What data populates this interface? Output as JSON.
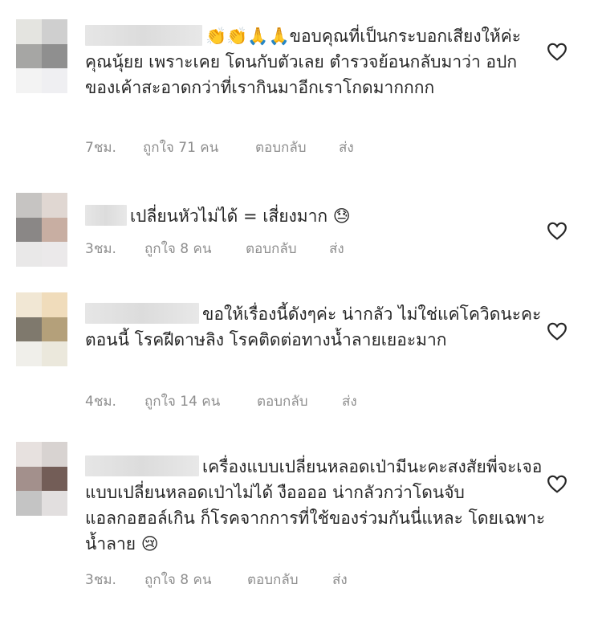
{
  "comments": [
    {
      "text": "👏👏🙏🙏ขอบคุณที่เป็นกระบอกเสียงให้ค่ะคุณนุ้ยย เพราะเคย โดนกับตัวเลย ตำรวจย้อนกลับมาว่า อปก ของเค้าสะอาดกว่าที่เรากินมาอีกเราโกดมากกกก",
      "time": "7ชม.",
      "likes": "ถูกใจ 71 คน",
      "reply": "ตอบกลับ",
      "send": "ส่ง"
    },
    {
      "text": "เปลี่ยนหัวไม่ได้ = เสี่ยงมาก 😓",
      "time": "3ชม.",
      "likes": "ถูกใจ 8 คน",
      "reply": "ตอบกลับ",
      "send": "ส่ง"
    },
    {
      "text": "ขอให้เรื่องนี้ดังๆค่ะ น่ากลัว ไม่ใช่แค่โควิดนะคะตอนนี้ โรคฝีดาษลิง โรคติดต่อทางน้ำลายเยอะมาก",
      "time": "4ชม.",
      "likes": "ถูกใจ 14 คน",
      "reply": "ตอบกลับ",
      "send": "ส่ง"
    },
    {
      "text": "เครื่องแบบเปลี่ยนหลอดเป่ามีนะคะสงสัยพี่จะเจอแบบเปลี่ยนหลอดเป่าไม่ได้ งืออออ น่ากลัวกว่าโดนจับแอลกอฮอล์เกิน ก็โรคจากการที่ใช้ของร่วมกันนี่แหละ โดยเฉพาะน้ำลาย 😢",
      "time": "3ชม.",
      "likes": "ถูกใจ 8 คน",
      "reply": "ตอบกลับ",
      "send": "ส่ง"
    }
  ],
  "icons": {
    "like": "heart-outline-icon"
  },
  "colors": {
    "text": "#262626",
    "meta": "#8e8e8e",
    "heart": "#262626"
  }
}
